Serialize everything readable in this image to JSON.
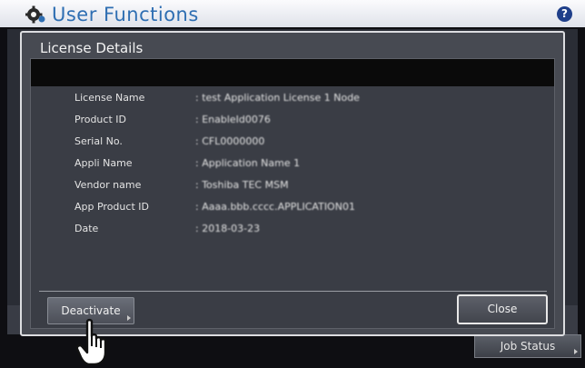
{
  "app": {
    "title": "User Functions",
    "help_label": "?",
    "job_status_label": "Job Status"
  },
  "dialog": {
    "title": "License Details",
    "rows": [
      {
        "label": "License Name",
        "value": ": test Application License 1 Node"
      },
      {
        "label": "Product ID",
        "value": ": EnableId0076"
      },
      {
        "label": "Serial No.",
        "value": ": CFL0000000"
      },
      {
        "label": "Appli Name",
        "value": ": Application Name 1"
      },
      {
        "label": "Vendor name",
        "value": ": Toshiba TEC MSM"
      },
      {
        "label": "App Product ID",
        "value": ": Aaaa.bbb.cccc.APPLICATION01"
      },
      {
        "label": "Date",
        "value": ": 2018-03-23"
      }
    ],
    "deactivate_label": "Deactivate",
    "close_label": "Close"
  },
  "icons": {
    "gear": "gear-icon",
    "help": "help-icon",
    "cursor": "hand-pointer-icon"
  },
  "colors": {
    "title_blue": "#2e6eb2",
    "dialog_bg": "#474a52",
    "header_bg": "#eef0f5"
  }
}
